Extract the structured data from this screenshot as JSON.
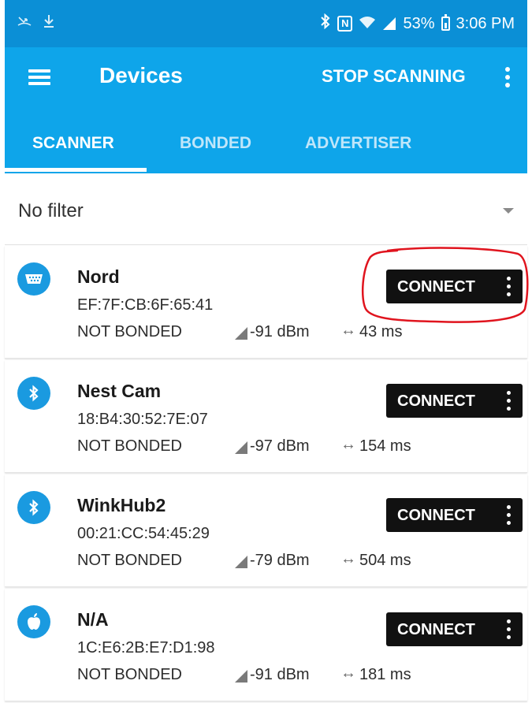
{
  "colors": {
    "status_bar": "#0b8fd6",
    "app_bar": "#0ea5ea",
    "connect_button": "#111111",
    "device_icon": "#1a9ae0",
    "annotation": "#e0141e"
  },
  "status_bar": {
    "battery": "53%",
    "time": "3:06 PM",
    "icons": [
      "missed-call-icon",
      "download-icon",
      "bluetooth-icon",
      "nfc-icon",
      "wifi-icon",
      "signal-icon",
      "battery-icon"
    ]
  },
  "app_bar": {
    "title": "Devices",
    "action": "STOP SCANNING"
  },
  "tabs": [
    {
      "label": "SCANNER",
      "active": true
    },
    {
      "label": "BONDED",
      "active": false
    },
    {
      "label": "ADVERTISER",
      "active": false
    }
  ],
  "filter": {
    "selected": "No filter"
  },
  "devices": [
    {
      "name": "Nord",
      "address": "EF:7F:CB:6F:65:41",
      "bond_state": "NOT BONDED",
      "rssi": "-91 dBm",
      "interval": "43 ms",
      "icon": "serial-port-icon",
      "connect_label": "CONNECT"
    },
    {
      "name": "Nest Cam",
      "address": "18:B4:30:52:7E:07",
      "bond_state": "NOT BONDED",
      "rssi": "-97 dBm",
      "interval": "154 ms",
      "icon": "bluetooth-icon",
      "connect_label": "CONNECT"
    },
    {
      "name": "WinkHub2",
      "address": "00:21:CC:54:45:29",
      "bond_state": "NOT BONDED",
      "rssi": "-79 dBm",
      "interval": "504 ms",
      "icon": "bluetooth-icon",
      "connect_label": "CONNECT"
    },
    {
      "name": "N/A",
      "address": "1C:E6:2B:E7:D1:98",
      "bond_state": "NOT BONDED",
      "rssi": "-91 dBm",
      "interval": "181 ms",
      "icon": "apple-icon",
      "connect_label": "CONNECT"
    }
  ]
}
